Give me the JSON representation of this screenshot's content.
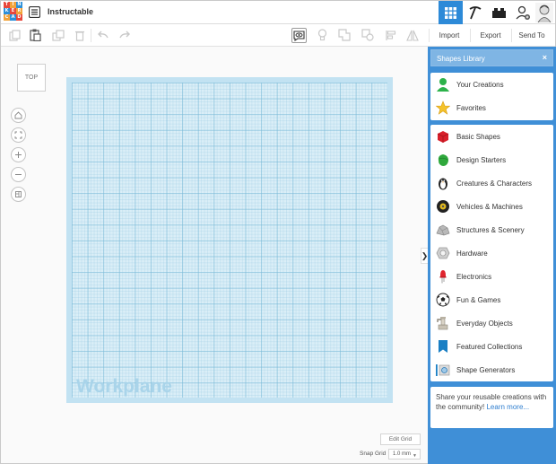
{
  "app": {
    "title": "Instructable",
    "logo_letters": [
      "T",
      "I",
      "N",
      "K",
      "E",
      "R",
      "C",
      "A",
      "D"
    ],
    "logo_colors": [
      "#e8473b",
      "#f2a33a",
      "#2c8fd8",
      "#2c8fd8",
      "#e8473b",
      "#f2a33a",
      "#f2a33a",
      "#2c8fd8",
      "#e8473b"
    ]
  },
  "toolbar": {
    "import_label": "Import",
    "export_label": "Export",
    "send_to_label": "Send To"
  },
  "canvas": {
    "view_label": "TOP",
    "workplane_label": "Workplane",
    "edit_grid_label": "Edit Grid",
    "snap_grid_label": "Snap Grid",
    "snap_grid_value": "1.0 mm"
  },
  "library": {
    "header": "Shapes Library",
    "close_glyph": "×",
    "top_items": [
      {
        "label": "Your Creations",
        "icon": "person-icon"
      },
      {
        "label": "Favorites",
        "icon": "star-icon"
      }
    ],
    "items": [
      {
        "label": "Basic Shapes",
        "icon": "red-cube-icon"
      },
      {
        "label": "Design Starters",
        "icon": "green-blob-icon"
      },
      {
        "label": "Creatures & Characters",
        "icon": "penguin-icon"
      },
      {
        "label": "Vehicles & Machines",
        "icon": "wheel-icon"
      },
      {
        "label": "Structures & Scenery",
        "icon": "rock-icon"
      },
      {
        "label": "Hardware",
        "icon": "nut-icon"
      },
      {
        "label": "Electronics",
        "icon": "led-icon"
      },
      {
        "label": "Fun & Games",
        "icon": "soccer-ball-icon"
      },
      {
        "label": "Everyday Objects",
        "icon": "faucet-icon"
      },
      {
        "label": "Featured Collections",
        "icon": "bookmark-icon"
      },
      {
        "label": "Shape Generators",
        "icon": "generator-icon"
      }
    ],
    "share_text": "Share your reusable creations with the community!",
    "share_link": "Learn more..."
  },
  "colors": {
    "accent": "#2d8ad8",
    "panel_bg": "#3f8fd7",
    "workplane": "#daeef7"
  }
}
